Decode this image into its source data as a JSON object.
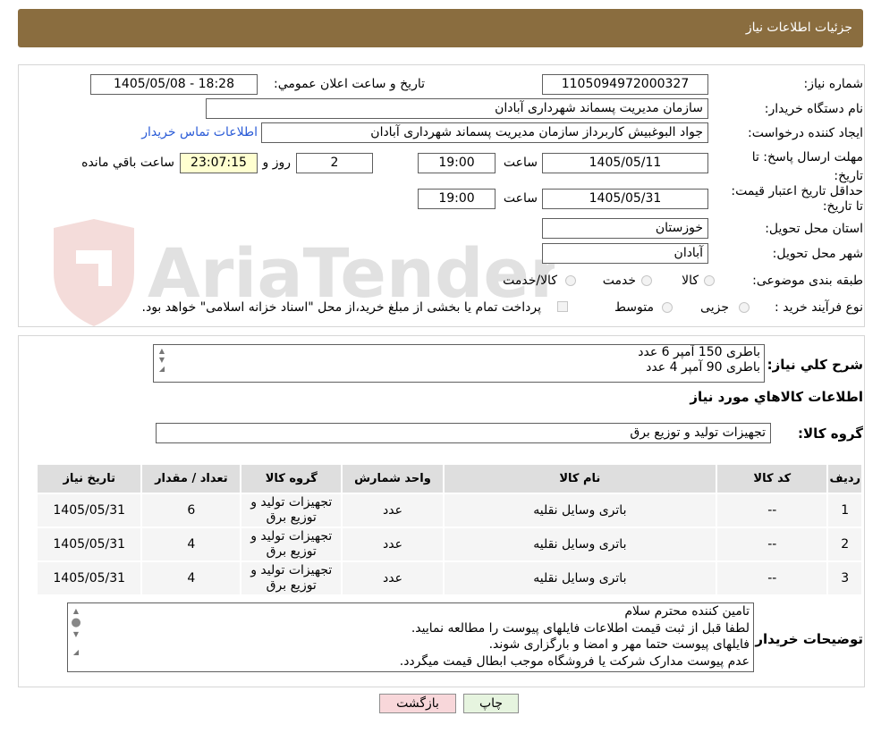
{
  "header": {
    "title": "جزئیات اطلاعات نیاز"
  },
  "need_number": {
    "label": "شماره نیاز:",
    "value": "1105094972000327"
  },
  "announce": {
    "label": "تاریخ و ساعت اعلان عمومي:",
    "value": "1405/05/08 - 18:28"
  },
  "buyer_org": {
    "label": "نام دستگاه خریدار:",
    "value": "سازمان مدیریت پسماند شهرداری آبادان"
  },
  "requester": {
    "label": "ایجاد کننده درخواست:",
    "value": "جواد البوغبیش کاربرداز سازمان مدیریت پسماند شهرداری آبادان",
    "contact_link": "اطلاعات تماس خریدار"
  },
  "reply_deadline": {
    "label": "مهلت ارسال پاسخ: تا تاریخ:",
    "date": "1405/05/11",
    "time_label": "ساعت",
    "time": "19:00",
    "days": "2",
    "days_label": "روز و",
    "remaining": "23:07:15",
    "remaining_label": "ساعت باقي مانده"
  },
  "price_validity": {
    "label": "حداقل تاریخ اعتبار قیمت: تا تاریخ:",
    "date": "1405/05/31",
    "time_label": "ساعت",
    "time": "19:00"
  },
  "province": {
    "label": "استان محل تحویل:",
    "value": "خوزستان"
  },
  "city": {
    "label": "شهر محل تحویل:",
    "value": "آبادان"
  },
  "category": {
    "label": "طبقه بندی موضوعی:",
    "options": [
      "کالا",
      "خدمت",
      "کالا/خدمت"
    ]
  },
  "process": {
    "label": "نوع فرآیند خرید :",
    "options": [
      "جزیی",
      "متوسط"
    ],
    "note": "پرداخت تمام یا بخشی از مبلغ خرید،از محل \"اسناد خزانه اسلامی\" خواهد بود."
  },
  "watermark": {
    "text": "AriaTender.neT"
  },
  "description": {
    "label": "شرح کلي نیاز:",
    "lines": [
      "باطری 150 آمپر 6 عدد",
      "باطری 90 آمپر 4 عدد"
    ]
  },
  "goods_section": {
    "title": "اطلاعات کالاهاي مورد نیاز"
  },
  "goods_group": {
    "label": "گروه کالا:",
    "value": "تجهیزات تولید و توزیع برق"
  },
  "table": {
    "headers": [
      "ردیف",
      "کد کالا",
      "نام کالا",
      "واحد شمارش",
      "گروه کالا",
      "تعداد / مقدار",
      "تاریخ نیاز"
    ],
    "rows": [
      [
        "1",
        "--",
        "باتری وسایل نقلیه",
        "عدد",
        "تجهیزات تولید و توزیع برق",
        "6",
        "1405/05/31"
      ],
      [
        "2",
        "--",
        "باتری وسایل نقلیه",
        "عدد",
        "تجهیزات تولید و توزیع برق",
        "4",
        "1405/05/31"
      ],
      [
        "3",
        "--",
        "باتری وسایل نقلیه",
        "عدد",
        "تجهیزات تولید و توزیع برق",
        "4",
        "1405/05/31"
      ]
    ]
  },
  "buyer_notes": {
    "label": "توضیحات خریدار:",
    "lines": [
      "تامین کننده محترم سلام",
      "لطفا قبل از ثبت قیمت اطلاعات فایلهای پیوست را مطالعه نمایید.",
      "فایلهای پیوست حتما مهر و امضا و بارگزاری شوند.",
      "عدم پیوست مدارک شرکت یا فروشگاه موجب ابطال قیمت میگردد."
    ]
  },
  "buttons": {
    "print": "چاپ",
    "back": "بازگشت"
  },
  "colors": {
    "header_bg": "#8a6d3f",
    "link": "#2a5bd7",
    "back_btn": "#f8d7da",
    "print_btn": "#e6f4df"
  }
}
